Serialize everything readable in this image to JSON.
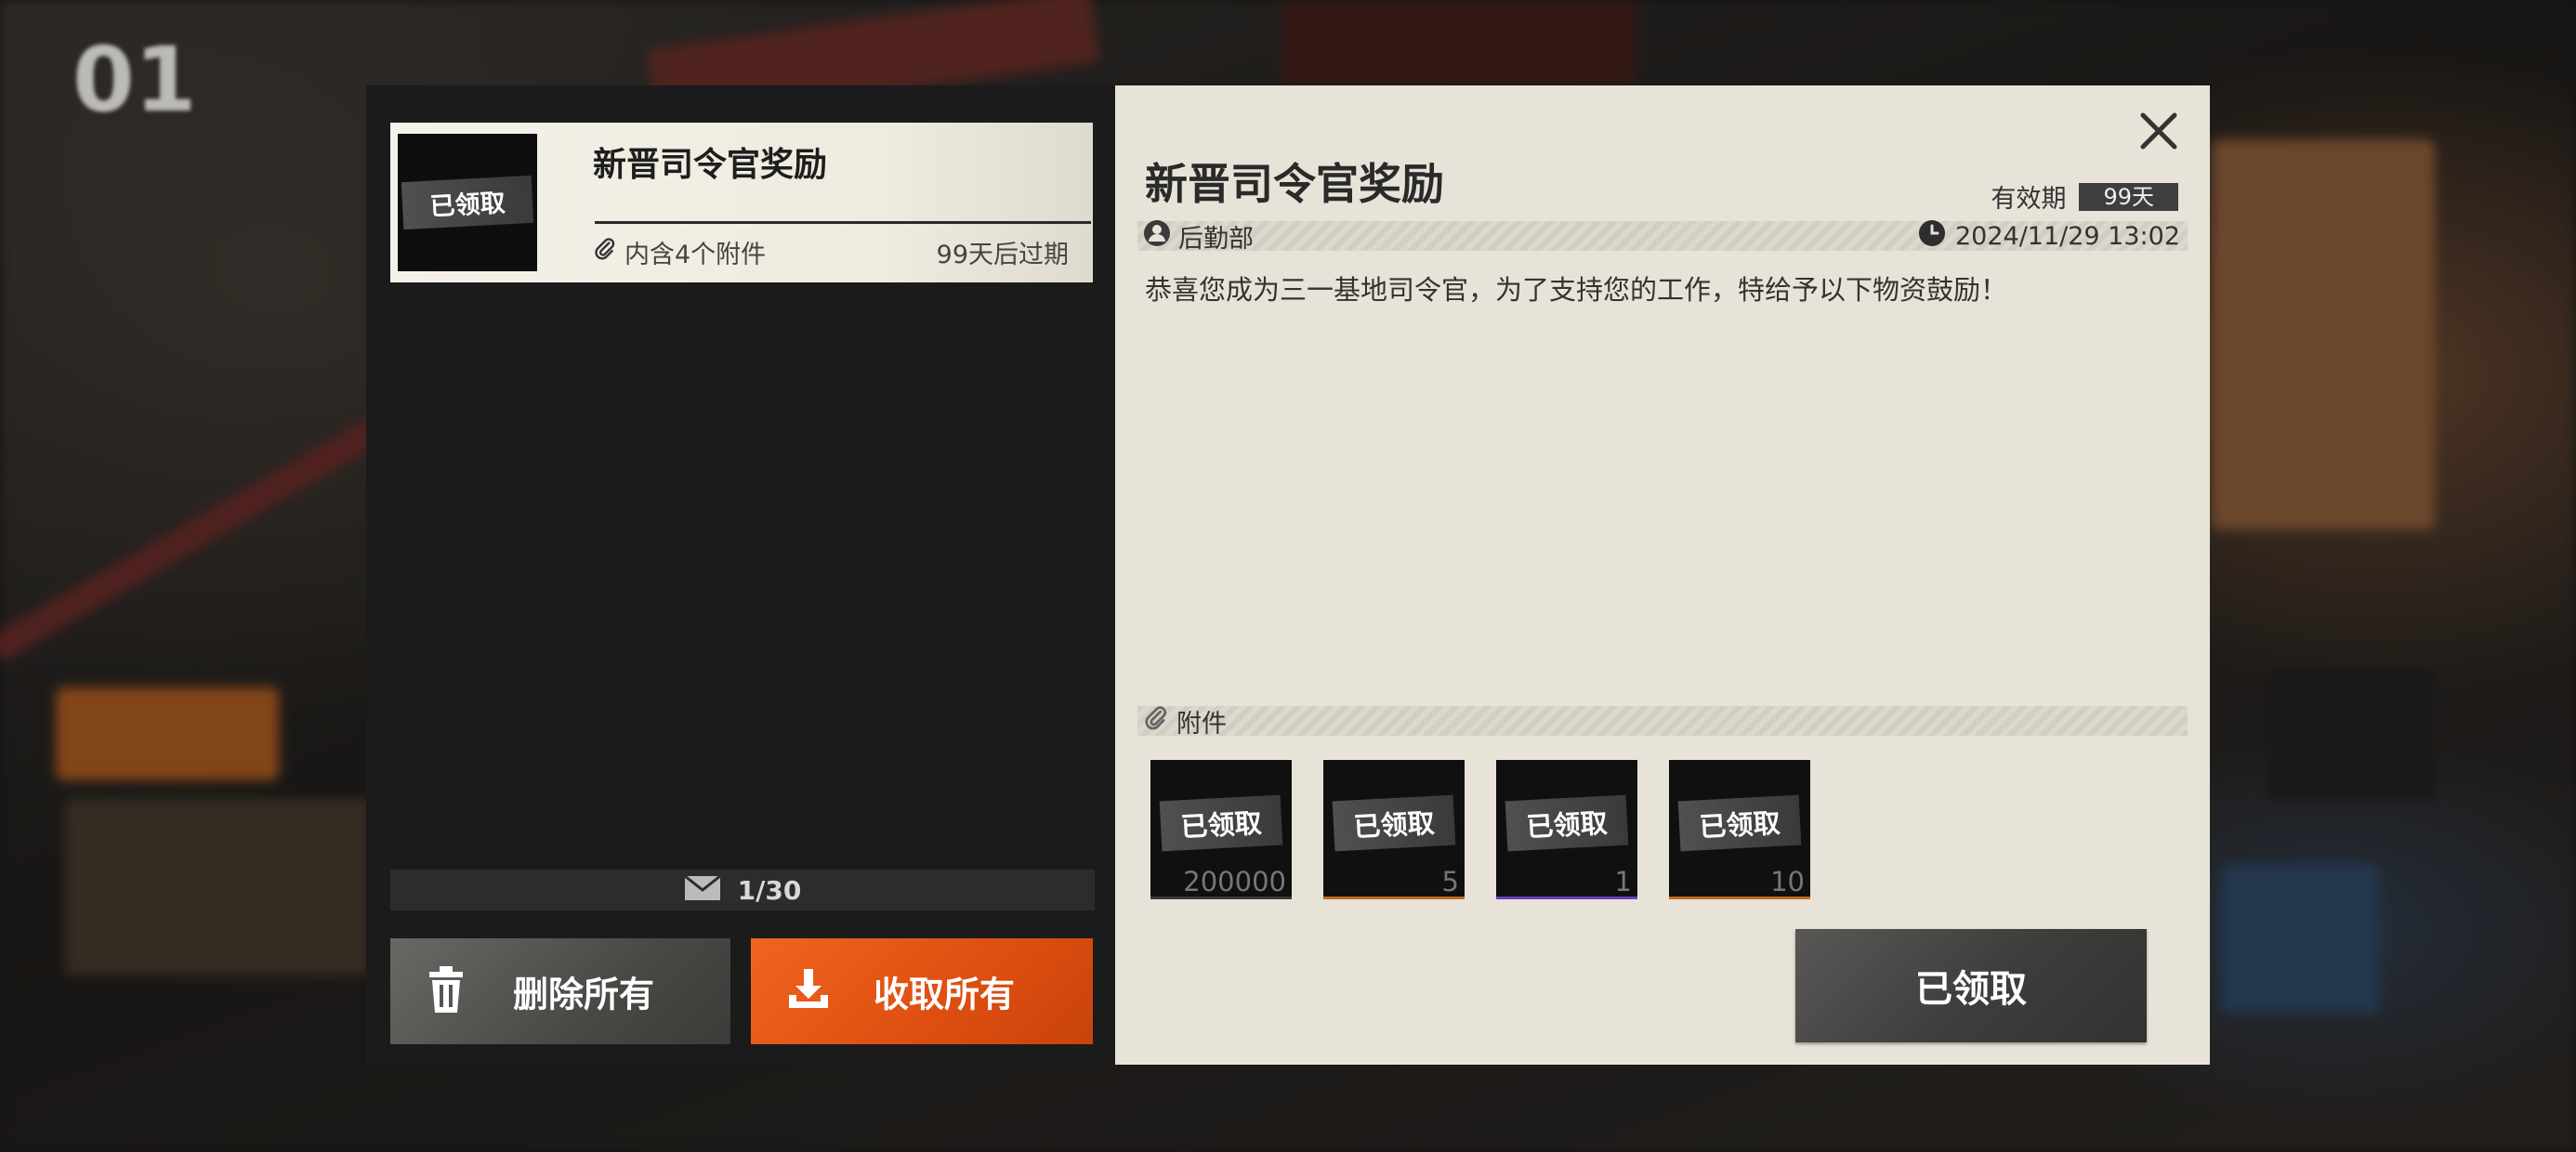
{
  "mail_list": {
    "item": {
      "title": "新晋司令官奖励",
      "status_tag": "已领取",
      "attachments_text": "内含4个附件",
      "expire_text": "99天后过期"
    },
    "counter": "1/30",
    "delete_all_label": "删除所有",
    "claim_all_label": "收取所有"
  },
  "mail_detail": {
    "title": "新晋司令官奖励",
    "validity_label": "有效期",
    "validity_value": "99天",
    "sender": "后勤部",
    "sent_time": "2024/11/29 13:02",
    "body": "恭喜您成为三一基地司令官，为了支持您的工作，特给予以下物资鼓励！",
    "attachments_label": "附件",
    "rewards": [
      {
        "status": "已领取",
        "quantity": "200000",
        "rarity_color": "#3a3a3a"
      },
      {
        "status": "已领取",
        "quantity": "5",
        "rarity_color": "#c06a20"
      },
      {
        "status": "已领取",
        "quantity": "1",
        "rarity_color": "#6a3fc0"
      },
      {
        "status": "已领取",
        "quantity": "10",
        "rarity_color": "#c06a20"
      }
    ],
    "claimed_button_label": "已领取"
  },
  "colors": {
    "accent_orange": "#e05212",
    "panel_dark": "#1b1b1b",
    "panel_light": "#e7e3d8"
  }
}
